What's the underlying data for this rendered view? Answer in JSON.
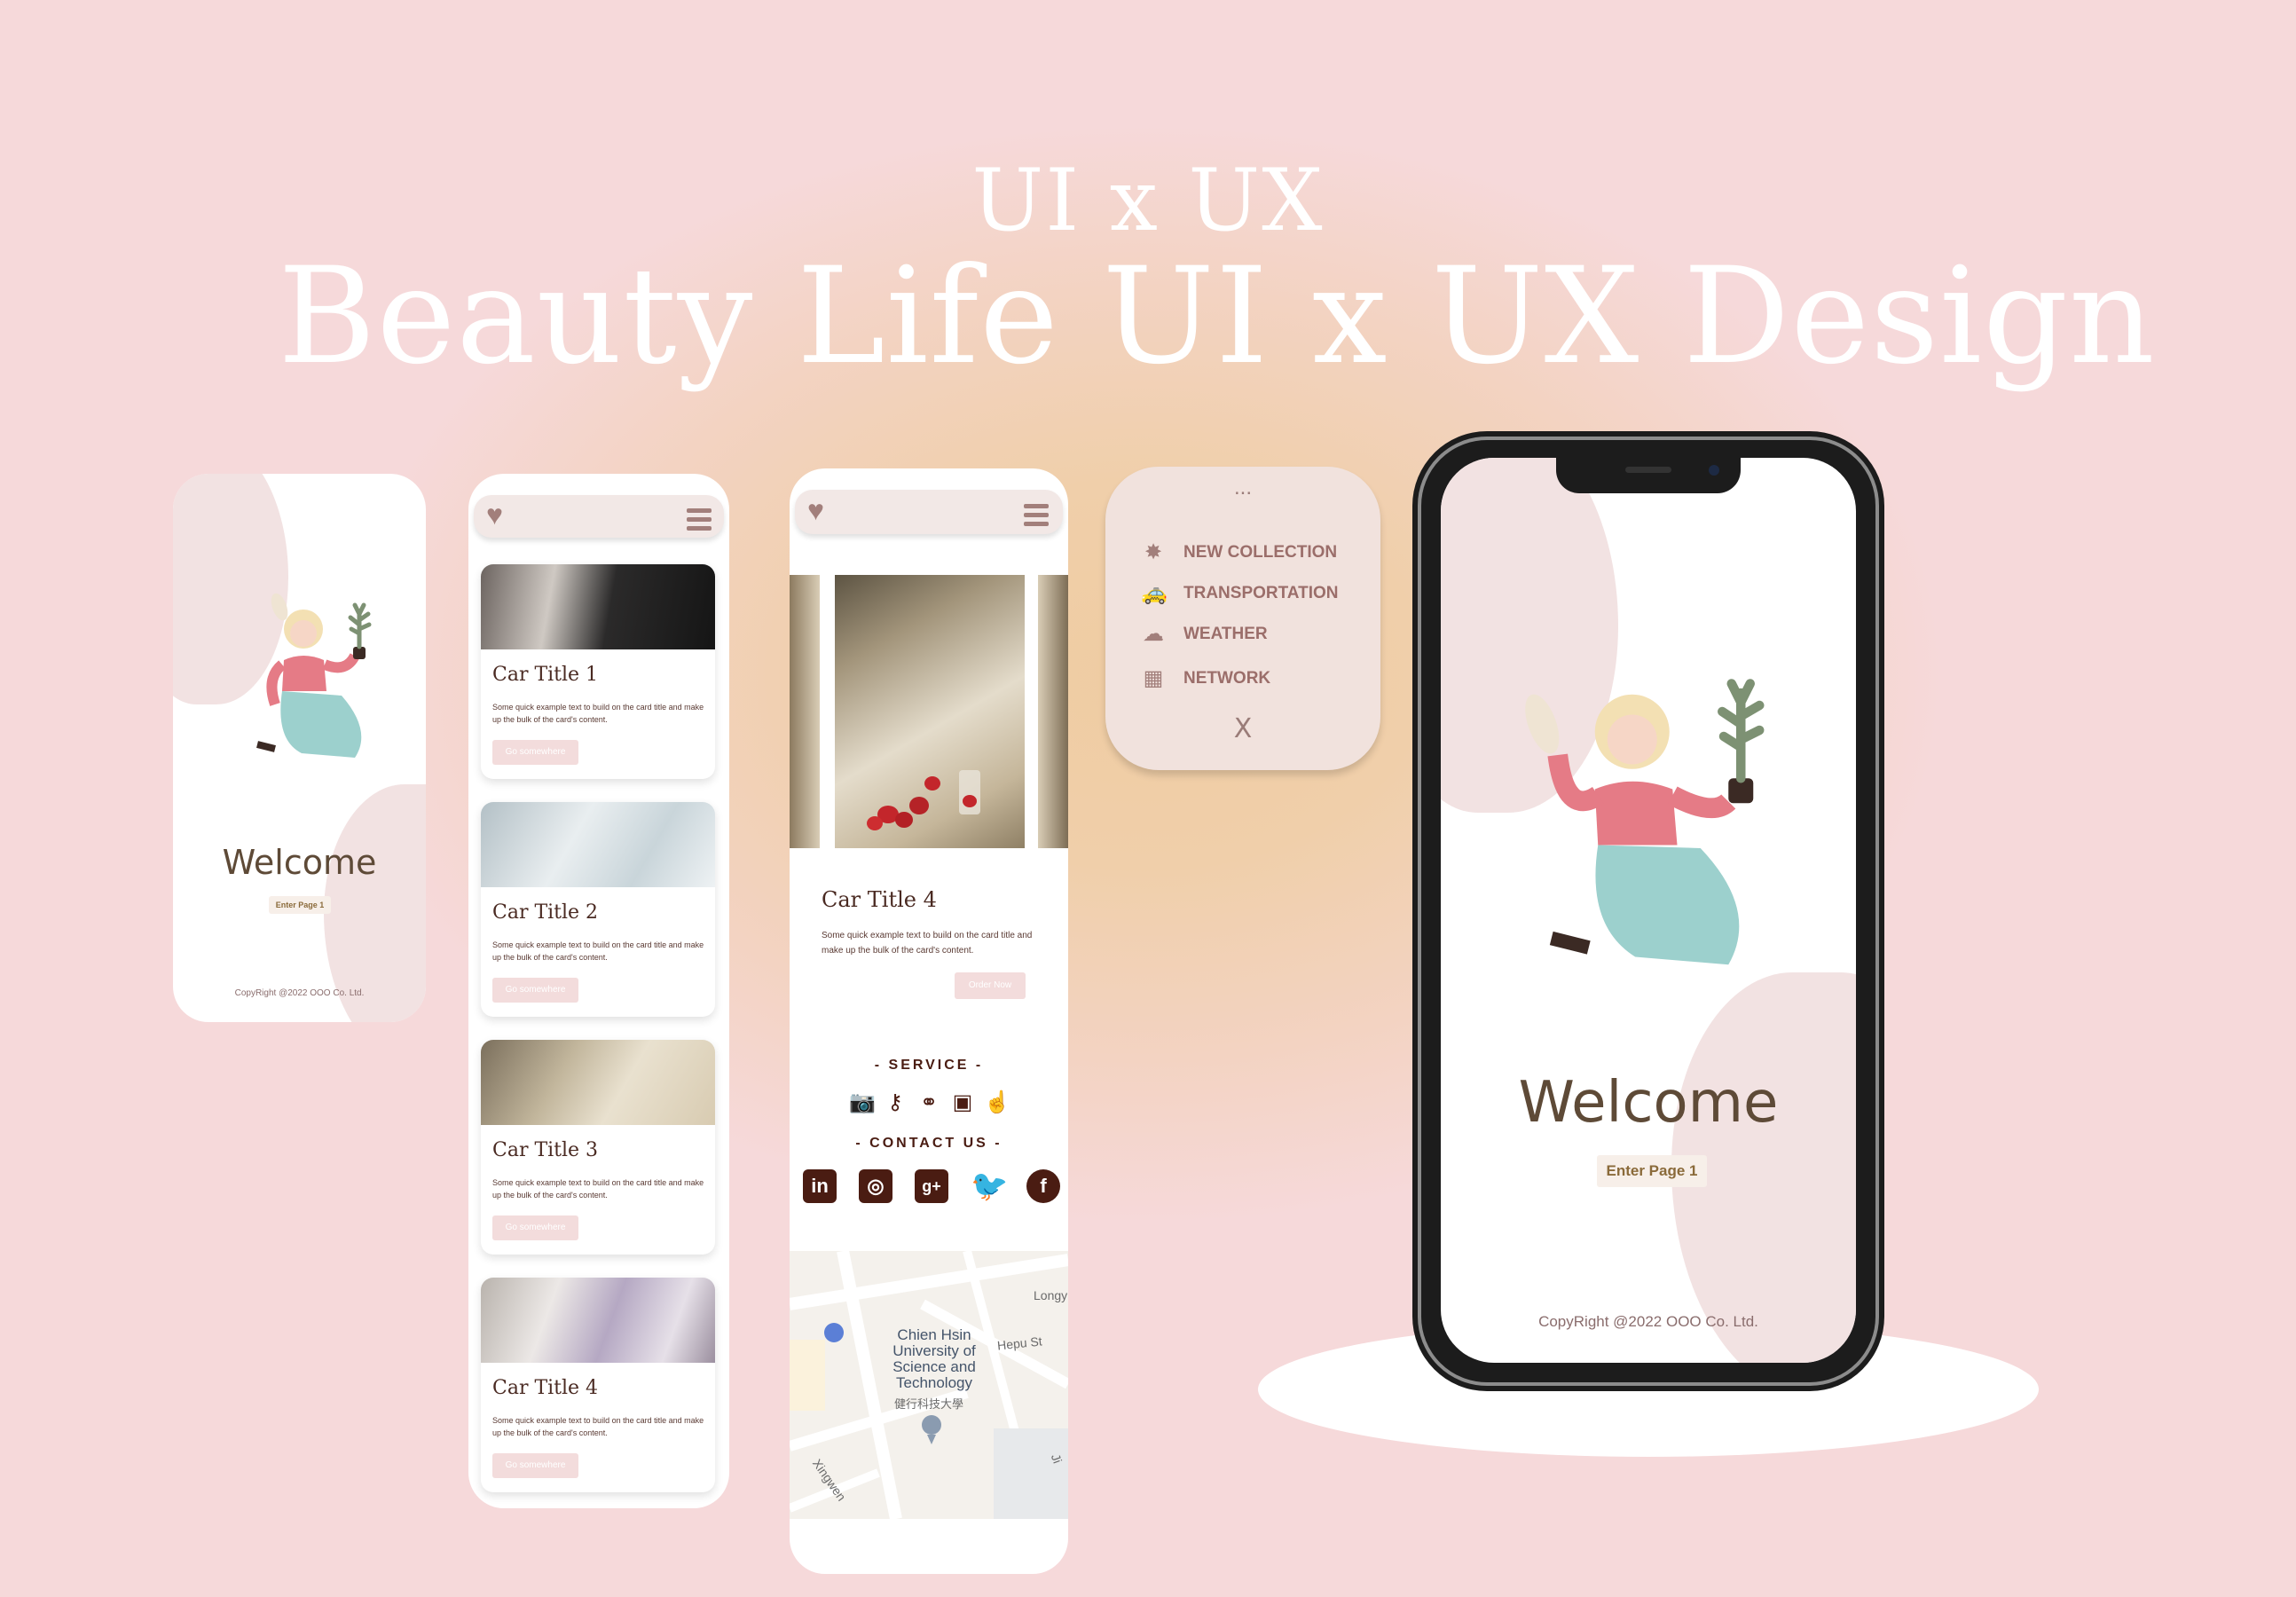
{
  "header": {
    "subtitle": "UI x UX",
    "title": "Beauty Life UI x UX Design"
  },
  "welcome_small": {
    "welcome": "Welcome",
    "enter_button": "Enter Page 1",
    "copyright": "CopyRight @2022 OOO Co. Ltd."
  },
  "list_screen": {
    "cards": [
      {
        "title": "Car Title 1",
        "text": "Some quick example text to build on the card title and make up the bulk of the card's content.",
        "button": "Go somewhere"
      },
      {
        "title": "Car Title 2",
        "text": "Some quick example text to build on the card title and make up the bulk of the card's content.",
        "button": "Go somewhere"
      },
      {
        "title": "Car Title 3",
        "text": "Some quick example text to build on the card title and make up the bulk of the card's content.",
        "button": "Go somewhere"
      },
      {
        "title": "Car Title 4",
        "text": "Some quick example text to build on the card title and make up the bulk of the card's content.",
        "button": "Go somewhere"
      }
    ]
  },
  "detail_screen": {
    "title": "Car Title 4",
    "text": "Some quick example text to build on the card title and make up the bulk of the card's content.",
    "button": "Order Now",
    "service_heading": "- SERVICE -",
    "contact_heading": "- CONTACT US -",
    "service_icons": [
      "camera-icon",
      "key-icon",
      "binoculars-icon",
      "monitor-code-icon",
      "pointer-hand-icon"
    ],
    "social_icons": [
      "linkedin-icon",
      "instagram-icon",
      "google-plus-icon",
      "twitter-icon",
      "facebook-icon"
    ],
    "social_glyphs": {
      "linkedin": "in",
      "instagram": "◎",
      "google": "g+",
      "twitter": "🐦",
      "facebook": "f"
    },
    "map": {
      "place_name_en": "Chien Hsin University of Science and Technology",
      "place_name_zh": "健行科技大學",
      "street_1": "Hepu St",
      "street_2": "Longyu",
      "street_3": "Xingwen",
      "street_4": "Ji"
    }
  },
  "menu": {
    "dots": "...",
    "items": [
      {
        "icon": "star-shape-icon",
        "label": "NEW COLLECTION"
      },
      {
        "icon": "taxi-icon",
        "label": "TRANSPORTATION"
      },
      {
        "icon": "cloud-icon",
        "label": "WEATHER"
      },
      {
        "icon": "network-device-icon",
        "label": "NETWORK"
      }
    ],
    "close": "X"
  },
  "iphone_screen": {
    "welcome": "Welcome",
    "enter_button": "Enter Page 1",
    "copyright": "CopyRight @2022 OOO Co. Ltd."
  },
  "colors": {
    "background": "#f6d9da",
    "glow": "#efcca2",
    "accent_brown": "#4a1c12",
    "accent_mauve": "#a27f7b",
    "blob_pink": "#f2e2e2",
    "button_pink": "#f3dcdc"
  }
}
